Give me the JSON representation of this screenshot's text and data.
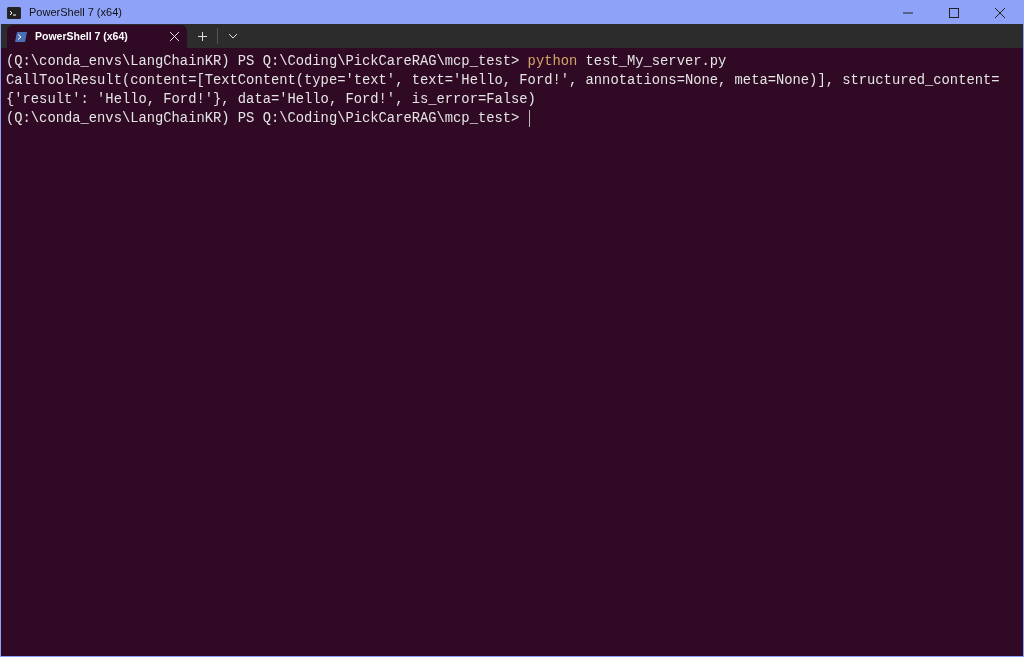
{
  "window": {
    "title": "PowerShell 7 (x64)"
  },
  "tabs": [
    {
      "label": "PowerShell 7 (x64)",
      "selected": true
    }
  ],
  "terminal": {
    "cursor": true,
    "lines": [
      {
        "segments": [
          {
            "kind": "output",
            "text": "(Q:\\conda_envs\\LangChainKR) PS Q:\\Coding\\PickCareRAG\\mcp_test> "
          },
          {
            "kind": "command",
            "text": "python"
          },
          {
            "kind": "output",
            "text": " test_My_server.py"
          }
        ]
      },
      {
        "segments": [
          {
            "kind": "output",
            "text": "CallToolResult(content=[TextContent(type='text', text='Hello, Ford!', annotations=None, meta=None)], structured_content="
          }
        ]
      },
      {
        "segments": [
          {
            "kind": "output",
            "text": "{'result': 'Hello, Ford!'}, data='Hello, Ford!', is_error=False)"
          }
        ]
      },
      {
        "segments": [
          {
            "kind": "output",
            "text": "(Q:\\conda_envs\\LangChainKR) PS Q:\\Coding\\PickCareRAG\\mcp_test> "
          }
        ]
      }
    ]
  }
}
